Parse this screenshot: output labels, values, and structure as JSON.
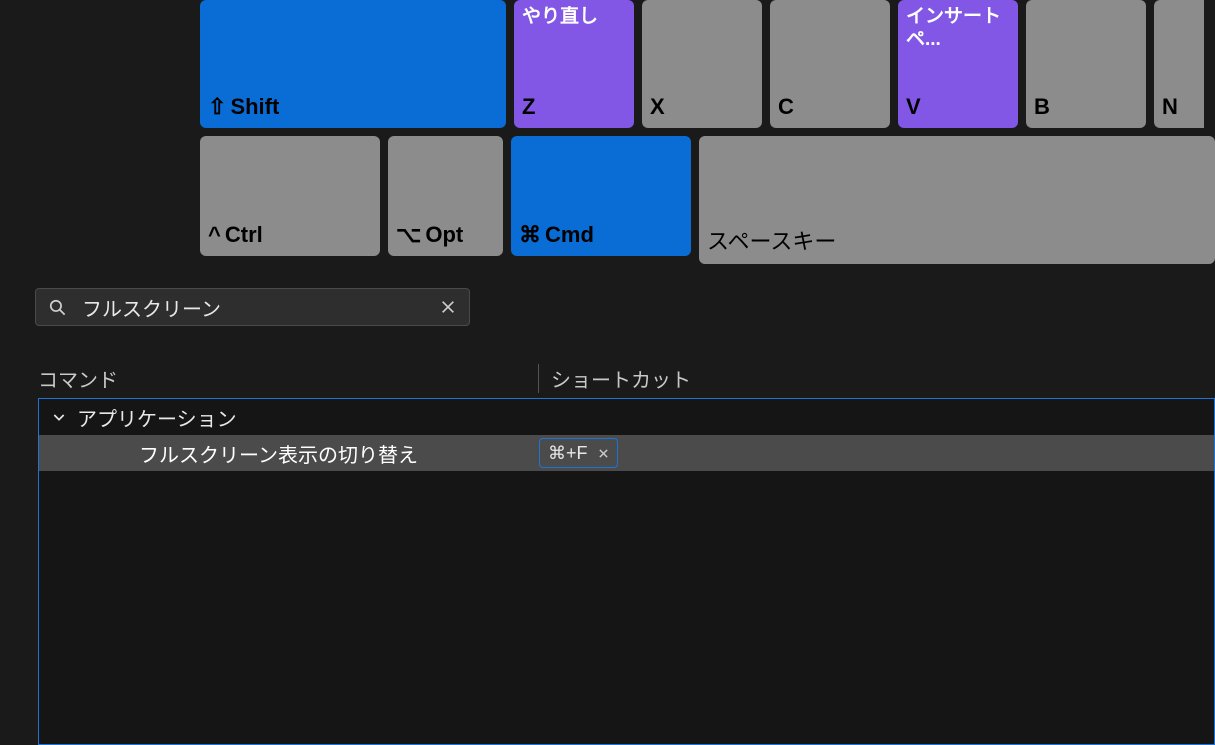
{
  "keyboard": {
    "row1": [
      {
        "name": "shift-key",
        "top": "",
        "bottom_glyph": "⇧",
        "bottom": "Shift",
        "style": "blue",
        "cls": "shift"
      },
      {
        "name": "z-key",
        "top": "やり直し",
        "bottom": "Z",
        "style": "purple",
        "cls": "letter"
      },
      {
        "name": "x-key",
        "top": "",
        "bottom": "X",
        "style": "gray",
        "cls": "letter"
      },
      {
        "name": "c-key",
        "top": "",
        "bottom": "C",
        "style": "gray",
        "cls": "letter"
      },
      {
        "name": "v-key",
        "top": "インサートペ...",
        "bottom": "V",
        "style": "purple",
        "cls": "letter"
      },
      {
        "name": "b-key",
        "top": "",
        "bottom": "B",
        "style": "gray",
        "cls": "letter"
      },
      {
        "name": "n-key",
        "top": "",
        "bottom": "N",
        "style": "gray",
        "cls": "partial-right"
      }
    ],
    "row2": [
      {
        "name": "ctrl-key",
        "bottom_glyph": "^",
        "bottom": "Ctrl",
        "style": "gray",
        "cls": "mod"
      },
      {
        "name": "opt-key",
        "bottom_glyph": "⌥",
        "bottom": "Opt",
        "style": "gray",
        "cls": "small",
        "w": 115
      },
      {
        "name": "cmd-key",
        "bottom_glyph": "⌘",
        "bottom": "Cmd",
        "style": "blue",
        "cls": "mod cmd"
      },
      {
        "name": "space-key",
        "bottom": "スペースキー",
        "style": "gray",
        "cls": "space",
        "bold": false
      }
    ]
  },
  "search": {
    "value": "フルスクリーン"
  },
  "table": {
    "header_command": "コマンド",
    "header_shortcut": "ショートカット",
    "group_label": "アプリケーション",
    "item_label": "フルスクリーン表示の切り替え",
    "item_shortcut": "⌘+F"
  }
}
